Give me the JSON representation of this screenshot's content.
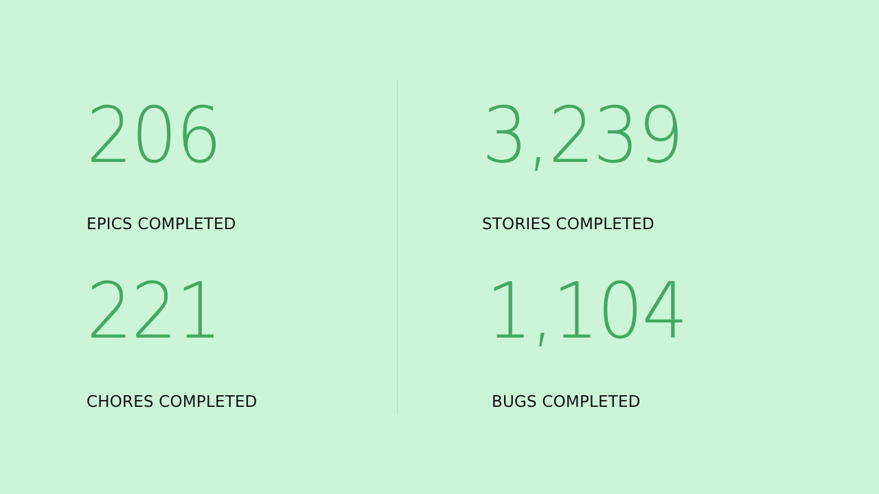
{
  "colors": {
    "background": "#ccf5d8",
    "value": "#43a862",
    "label": "#111111",
    "divider": "#b8dcc0"
  },
  "stats": [
    {
      "value": "206",
      "label": "EPICS COMPLETED"
    },
    {
      "value": "3,239",
      "label": "STORIES COMPLETED"
    },
    {
      "value": "221",
      "label": "CHORES COMPLETED"
    },
    {
      "value": "1,104",
      "label": "BUGS COMPLETED"
    }
  ]
}
